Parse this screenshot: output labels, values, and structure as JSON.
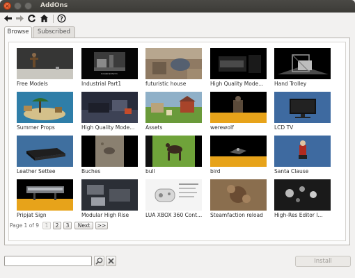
{
  "window": {
    "title": "AddOns"
  },
  "toolbar": {
    "icons": [
      "back-arrow-icon",
      "forward-arrow-icon",
      "refresh-icon",
      "home-icon",
      "help-icon"
    ]
  },
  "tabs": [
    {
      "label": "Browse",
      "active": true
    },
    {
      "label": "Subscribed",
      "active": false
    }
  ],
  "grid": {
    "items": [
      "Free Models",
      "Industrial Part1",
      "futuristic house",
      "High Quality Mode...",
      "Hand Trolley",
      "Summer Props",
      "High Quality Mode...",
      "Assets",
      "werewolf",
      "LCD TV",
      "Leather Settee",
      "Buches",
      "bull",
      "bird",
      "Santa Clause",
      "Pripjat Sign",
      "Modular High Rise",
      "LUA XBOX 360 Cont...",
      "Steamfaction reload",
      "High-Res Editor I..."
    ],
    "thumb_overlay_text": "Industrial Part 1"
  },
  "pager": {
    "label": "Page 1 of 9",
    "pages": [
      "1",
      "2",
      "3"
    ],
    "current": "1",
    "next": "Next",
    "last": ">>"
  },
  "bottom": {
    "search_value": "",
    "search_placeholder": "",
    "install_label": "Install",
    "install_enabled": false
  },
  "colors": {
    "titlebar": "#3c3b37",
    "close_button": "#e95420"
  }
}
